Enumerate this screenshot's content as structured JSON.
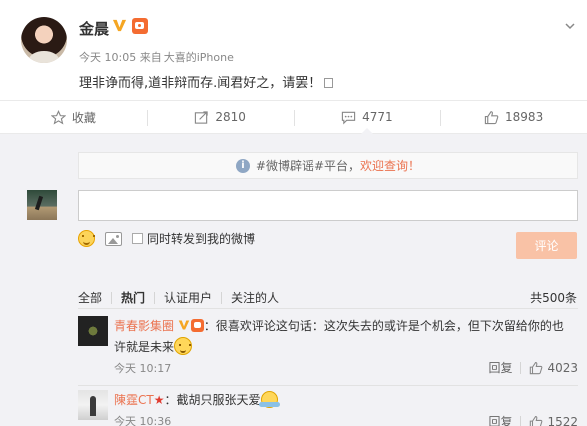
{
  "post": {
    "author": "金晨",
    "time": "今天 10:05",
    "source_prefix": "来自",
    "source": "大喜的iPhone",
    "text": "理非诤而得,道非辩而存.闻君好之，请罢！"
  },
  "actions": [
    {
      "icon": "star-icon",
      "label": "收藏"
    },
    {
      "icon": "repost-icon",
      "label": "2810"
    },
    {
      "icon": "comment-icon",
      "label": "4771"
    },
    {
      "icon": "like-icon",
      "label": "18983"
    }
  ],
  "comment_panel": {
    "notice_prefix": "#微博辟谣#平台，",
    "notice_link": "欢迎查询！",
    "input_value": "",
    "repost_checkbox_label": "同时转发到我的微博",
    "repost_checked": false,
    "submit_label": "评论",
    "filters": [
      "全部",
      "热门",
      "认证用户",
      "关注的人"
    ],
    "active_filter": "热门",
    "total": "共500条"
  },
  "comments": [
    {
      "author": "青春影集圈",
      "text_line1": "：很喜欢评论这句话：这次失去的或许是个机会，但下次留给你的也",
      "text_line2": "许就是未来",
      "time": "今天 10:17",
      "reply_label": "回复",
      "likes": "4023"
    },
    {
      "author": "陳霆CT",
      "text_line1": "：截胡只服张天爱",
      "time": "今天 10:36",
      "reply_label": "回复",
      "likes": "1522"
    }
  ],
  "colors": {
    "accent_orange": "#eb7350",
    "submit_disabled": "#f9c2a6",
    "panel_bg": "#f2f2f5"
  }
}
